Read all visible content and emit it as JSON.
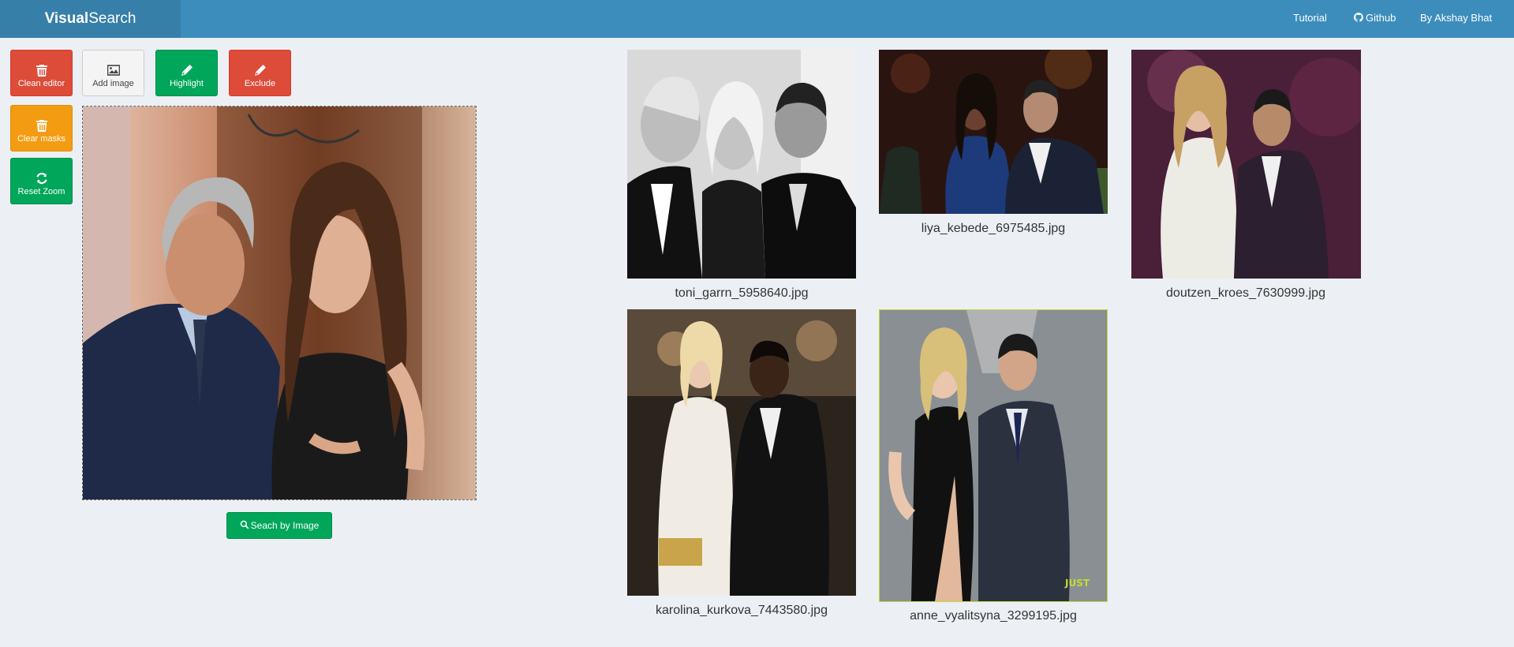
{
  "navbar": {
    "brand_bold": "Visual",
    "brand_light": "Search",
    "links": [
      "Tutorial",
      "Github",
      "By Akshay Bhat"
    ]
  },
  "toolbar": {
    "clean_editor": "Clean editor",
    "add_image": "Add image",
    "highlight": "Highlight",
    "exclude": "Exclude",
    "clear_masks": "Clear masks",
    "reset_zoom": "Reset Zoom"
  },
  "search_button": "Seach by Image",
  "results": [
    {
      "caption": "toni_garrn_5958640.jpg",
      "style": "grayscale"
    },
    {
      "caption": "liya_kebede_6975485.jpg",
      "style": "dark-party"
    },
    {
      "caption": "doutzen_kroes_7630999.jpg",
      "style": "purple-party"
    },
    {
      "caption": "karolina_kurkova_7443580.jpg",
      "style": "dark-event"
    },
    {
      "caption": "anne_vyalitsyna_3299195.jpg",
      "style": "red-carpet",
      "selected": true
    }
  ],
  "colors": {
    "navbar": "#3c8dbc",
    "brand_bg": "#367fa9",
    "red": "#dd4b39",
    "green": "#00a65a",
    "orange": "#f39c12",
    "page_bg": "#ecf0f5"
  },
  "icons": [
    "trash-icon",
    "image-icon",
    "pencil-icon",
    "refresh-icon",
    "search-icon",
    "github-icon"
  ]
}
